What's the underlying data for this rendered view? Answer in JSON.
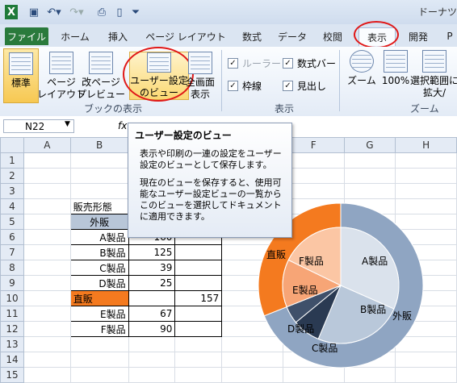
{
  "window": {
    "title": "ドーナツ"
  },
  "quick_access": {
    "items": [
      "excel-logo-icon",
      "save-icon",
      "undo-icon",
      "redo-icon",
      "print-preview-icon",
      "new-doc-icon",
      "customize-icon"
    ]
  },
  "tabs": [
    "ファイル",
    "ホーム",
    "挿入",
    "ページ レイアウト",
    "数式",
    "データ",
    "校閲",
    "表示",
    "開発",
    "P"
  ],
  "ribbon": {
    "normal": "標準",
    "page_layout": "ページ\nレイアウト",
    "page_break": "改ページ\nプレビュー",
    "custom_view": "ユーザー設定\nのビュー",
    "full_screen": "全画面\n表示",
    "group_book_view": "ブックの表示",
    "ruler": "ルーラー",
    "formula_bar": "数式バー",
    "gridlines": "枠線",
    "headings": "見出し",
    "group_show": "表示",
    "zoom": "ズーム",
    "zoom100": "100%",
    "zoom_selection": "選択範囲に\n拡大/",
    "group_zoom": "ズーム"
  },
  "formula_bar": {
    "cell": "N22",
    "fx": "fx"
  },
  "columns": [
    "A",
    "B",
    "C",
    "D",
    "E",
    "F",
    "G",
    "H"
  ],
  "rows": [
    "1",
    "2",
    "3",
    "4",
    "5",
    "6",
    "7",
    "8",
    "9",
    "10",
    "11",
    "12",
    "13",
    "14",
    "15"
  ],
  "table": {
    "header": "販売形態",
    "gaihan": "外販",
    "chokuhan": "直販",
    "items": [
      {
        "name": "A製品",
        "c": "160",
        "row": 6
      },
      {
        "name": "B製品",
        "c": "125",
        "row": 7
      },
      {
        "name": "C製品",
        "c": "39",
        "row": 8
      },
      {
        "name": "D製品",
        "c": "25",
        "row": 9
      },
      {
        "name": "E製品",
        "c": "67",
        "row": 11
      },
      {
        "name": "F製品",
        "c": "90",
        "row": 12
      }
    ],
    "chokuhan_total": "157"
  },
  "tooltip": {
    "title": "ユーザー設定のビュー",
    "p1": "表示や印刷の一連の設定をユーザー設定のビューとして保存します。",
    "p2": "現在のビューを保存すると、使用可能なユーザー設定ビューの一覧からこのビューを選択してドキュメントに適用できます。"
  },
  "chart_data": {
    "type": "donut",
    "series": [
      {
        "name": "販売形態",
        "categories": [
          "外販",
          "直販"
        ],
        "values": [
          349,
          157
        ]
      },
      {
        "name": "製品",
        "categories": [
          "A製品",
          "B製品",
          "C製品",
          "D製品",
          "E製品",
          "F製品"
        ],
        "values": [
          160,
          125,
          39,
          25,
          67,
          90
        ]
      }
    ],
    "colors": {
      "outer_gaihan": "#8fa5c2",
      "outer_chokuhan": "#f47a1f",
      "A": "#dae2ec",
      "B": "#b9c8da",
      "C": "#2a3a52",
      "D": "#3f506a",
      "E": "#f7a576",
      "F": "#fbc6a4"
    }
  }
}
